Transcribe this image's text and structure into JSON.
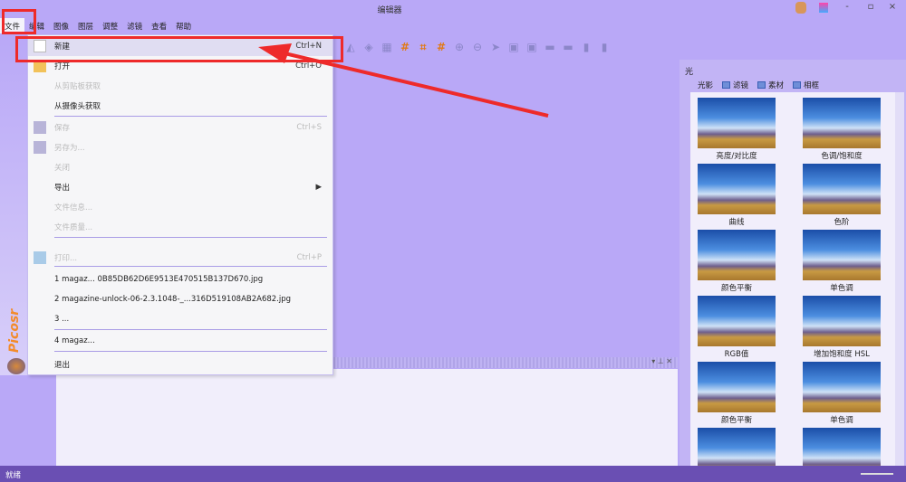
{
  "window": {
    "title": "编辑器",
    "controls": [
      "-",
      "▫",
      "×"
    ]
  },
  "menubar": [
    "文件",
    "编辑",
    "图像",
    "图层",
    "调整",
    "滤镜",
    "查看",
    "帮助"
  ],
  "file_menu": {
    "items": [
      {
        "label": "新建",
        "shortcut": "Ctrl+N",
        "enabled": true
      },
      {
        "label": "打开",
        "shortcut": "Ctrl+O",
        "enabled": true
      },
      {
        "label": "从剪贴板获取",
        "shortcut": "",
        "enabled": false
      },
      {
        "label": "从摄像头获取",
        "shortcut": "",
        "enabled": true
      },
      {
        "label": "保存",
        "shortcut": "Ctrl+S",
        "enabled": false
      },
      {
        "label": "另存为...",
        "shortcut": "",
        "enabled": false
      },
      {
        "label": "关闭",
        "shortcut": "",
        "enabled": false
      },
      {
        "label": "导出",
        "shortcut": "▶",
        "enabled": true
      },
      {
        "label": "文件信息...",
        "shortcut": "",
        "enabled": false
      },
      {
        "label": "文件质量...",
        "shortcut": "",
        "enabled": false
      },
      {
        "label": "打印...",
        "shortcut": "Ctrl+P",
        "enabled": false
      },
      {
        "label": "1 magaz... 0B85DB62D6E9513E470515B137D670.jpg",
        "shortcut": "",
        "enabled": true
      },
      {
        "label": "2 magazine-unlock-06-2.3.1048-_...316D519108AB2A682.jpg",
        "shortcut": "",
        "enabled": true
      },
      {
        "label": "3 ...",
        "shortcut": "",
        "enabled": true
      },
      {
        "label": "4 magaz...",
        "shortcut": "",
        "enabled": true
      },
      {
        "label": "退出",
        "shortcut": "",
        "enabled": true
      }
    ]
  },
  "logo": "Picosr",
  "right_panel": {
    "title": "光",
    "tabs": [
      "光影",
      "滤镜",
      "素材",
      "相框"
    ],
    "thumbnails": [
      "亮度/对比度",
      "色调/饱和度",
      "曲线",
      "色阶",
      "颜色平衡",
      "单色调",
      "RGB值",
      "增加饱和度 HSL",
      "颜色平衡",
      "单色调",
      "",
      ""
    ]
  },
  "status": {
    "text": "就绪"
  }
}
